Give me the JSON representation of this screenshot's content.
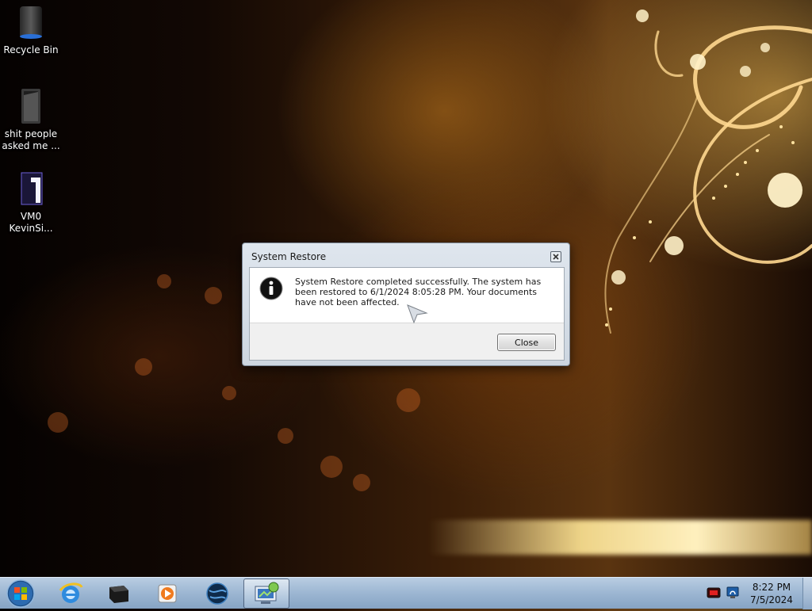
{
  "desktop": {
    "icons": [
      {
        "label": "Recycle Bin",
        "icon": "recycle-bin-icon"
      },
      {
        "label": "shit people asked me ...",
        "icon": "folder-icon"
      },
      {
        "label": "VM0 KevinSi...",
        "icon": "file-shortcut-icon"
      }
    ]
  },
  "dialog": {
    "title": "System Restore",
    "message": "System Restore completed successfully. The system has been restored to 6/1/2024 8:05:28 PM. Your documents have not been affected.",
    "close_button": "Close",
    "icon": "info-icon"
  },
  "taskbar": {
    "pinned": [
      {
        "name": "internet-explorer-icon"
      },
      {
        "name": "device-manager-icon"
      },
      {
        "name": "media-player-icon"
      },
      {
        "name": "browser-globe-icon"
      },
      {
        "name": "system-restore-icon",
        "active": true
      }
    ],
    "tray_icons": [
      "tray-media-icon",
      "tray-network-icon"
    ],
    "clock": {
      "time": "8:22 PM",
      "date": "7/5/2024"
    }
  },
  "colors": {
    "taskbar": "#9cb6d2",
    "dialog_frame": "#cdd6e0",
    "info_icon": "#111111"
  }
}
